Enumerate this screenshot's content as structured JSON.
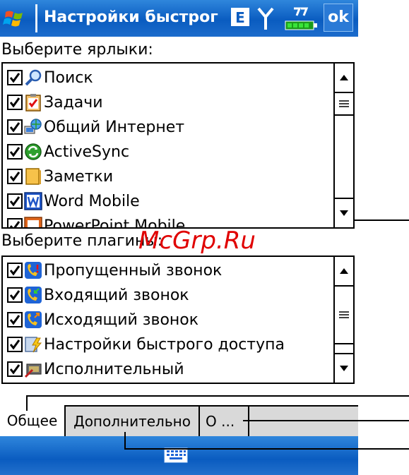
{
  "titlebar": {
    "title": "Настройки быстрог",
    "ok_label": "ok",
    "e_label": "E"
  },
  "shortcuts": {
    "label": "Выберите ярлыки:",
    "items": [
      {
        "label": "Поиск",
        "icon": "search-icon",
        "checked": true
      },
      {
        "label": "Задачи",
        "icon": "tasks-icon",
        "checked": true
      },
      {
        "label": "Общий Интернет",
        "icon": "internet-sharing-icon",
        "checked": true
      },
      {
        "label": "ActiveSync",
        "icon": "activesync-icon",
        "checked": true
      },
      {
        "label": "Заметки",
        "icon": "notes-icon",
        "checked": true
      },
      {
        "label": "Word Mobile",
        "icon": "word-icon",
        "checked": true
      },
      {
        "label": "PowerPoint Mobile",
        "icon": "powerpoint-icon",
        "checked": true
      }
    ]
  },
  "plugins": {
    "label": "Выберите плагины:",
    "items": [
      {
        "label": "Пропущенный звонок",
        "icon": "missed-call-icon",
        "checked": true
      },
      {
        "label": "Входящий звонок",
        "icon": "incoming-call-icon",
        "checked": true
      },
      {
        "label": "Исходящий звонок",
        "icon": "outgoing-call-icon",
        "checked": true
      },
      {
        "label": "Настройки быстрого доступа",
        "icon": "quick-settings-icon",
        "checked": true
      },
      {
        "label": "Исполнительный",
        "icon": "executor-icon",
        "checked": true
      }
    ]
  },
  "tabs": [
    {
      "label": "Общее",
      "active": true
    },
    {
      "label": "Дополнительно",
      "active": false
    },
    {
      "label": "О ...",
      "active": false
    }
  ],
  "watermark": "McGrp.Ru",
  "colors": {
    "titlebar": "#0a5cc0",
    "tabstrip": "#d9d9d9",
    "watermark": "#e00000"
  }
}
